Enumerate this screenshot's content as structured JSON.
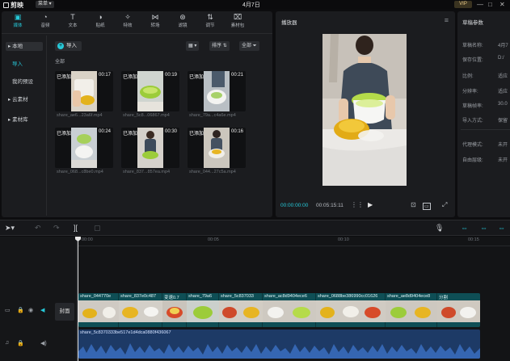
{
  "titlebar": {
    "app_name": "剪映",
    "menu_label": "菜单",
    "title": "4月7日",
    "vip_label": "VIP"
  },
  "toolbar_tabs": [
    {
      "label": "媒体",
      "icon": "media-icon",
      "active": true
    },
    {
      "label": "音频",
      "icon": "audio-icon",
      "active": false
    },
    {
      "label": "文本",
      "icon": "text-icon",
      "active": false
    },
    {
      "label": "贴纸",
      "icon": "sticker-icon",
      "active": false
    },
    {
      "label": "特效",
      "icon": "effects-icon",
      "active": false
    },
    {
      "label": "转场",
      "icon": "transition-icon",
      "active": false
    },
    {
      "label": "滤镜",
      "icon": "filter-icon",
      "active": false
    },
    {
      "label": "调节",
      "icon": "adjust-icon",
      "active": false
    },
    {
      "label": "素材包",
      "icon": "package-icon",
      "active": false
    }
  ],
  "left_nav": {
    "local": "▸ 本地",
    "import": "导入",
    "my_presets": "我的预设",
    "cloud": "▸ 云素材",
    "library": "▸ 素材库"
  },
  "media_bar": {
    "import_label": "导入",
    "sort_label": "排序",
    "filter_label": "全部",
    "section_label": "全部"
  },
  "media_items": [
    {
      "added": "已添加",
      "duration": "00:17",
      "filename": "share_ae6...23a6f.mp4"
    },
    {
      "added": "已添加",
      "duration": "00:19",
      "filename": "share_5c8...06867.mp4"
    },
    {
      "added": "已添加",
      "duration": "00:21",
      "filename": "share_79a...c4a6e.mp4"
    },
    {
      "added": "已添加",
      "duration": "00:24",
      "filename": "share_068...c8be0.mp4"
    },
    {
      "added": "已添加",
      "duration": "00:30",
      "filename": "share_837...857ea.mp4"
    },
    {
      "added": "已添加",
      "duration": "00:16",
      "filename": "share_044...27c5a.mp4"
    }
  ],
  "player": {
    "title": "播放器",
    "current_time": "00:00:00:00",
    "total_time": "00:05:15:11"
  },
  "properties": {
    "title": "草稿参数",
    "rows": [
      {
        "label": "草稿名称:",
        "value": "4月7"
      },
      {
        "label": "保存位置:",
        "value": "D:/"
      },
      {
        "label": "比例:",
        "value": "适应"
      },
      {
        "label": "分辨率:",
        "value": "适应"
      },
      {
        "label": "草稿帧率:",
        "value": "30.0"
      },
      {
        "label": "导入方式:",
        "value": "保留"
      },
      {
        "label": "代理模式:",
        "value": "未开"
      },
      {
        "label": "自由层级:",
        "value": "未开"
      }
    ]
  },
  "timeline": {
    "ruler_labels": [
      "00:00",
      "00:05",
      "00:10",
      "00:15"
    ],
    "cover_label": "封面",
    "clips": [
      {
        "label": "share_044770e"
      },
      {
        "label": "share_837e0c487"
      },
      {
        "label": "变速0.7"
      },
      {
        "label": "share_79a6"
      },
      {
        "label": "share_5c837033"
      },
      {
        "label": "share_ac8d9404ece6"
      },
      {
        "label": "share_0688be386990cc01626"
      },
      {
        "label": "share_ae8d9404ece8"
      },
      {
        "label": "分割"
      }
    ],
    "audio_label": "share_5c8370333be517e1d4dca0880f436067"
  },
  "colors": {
    "accent": "#26c9d9",
    "video_track": "#0e4e55",
    "audio_track": "#1d3a66"
  }
}
